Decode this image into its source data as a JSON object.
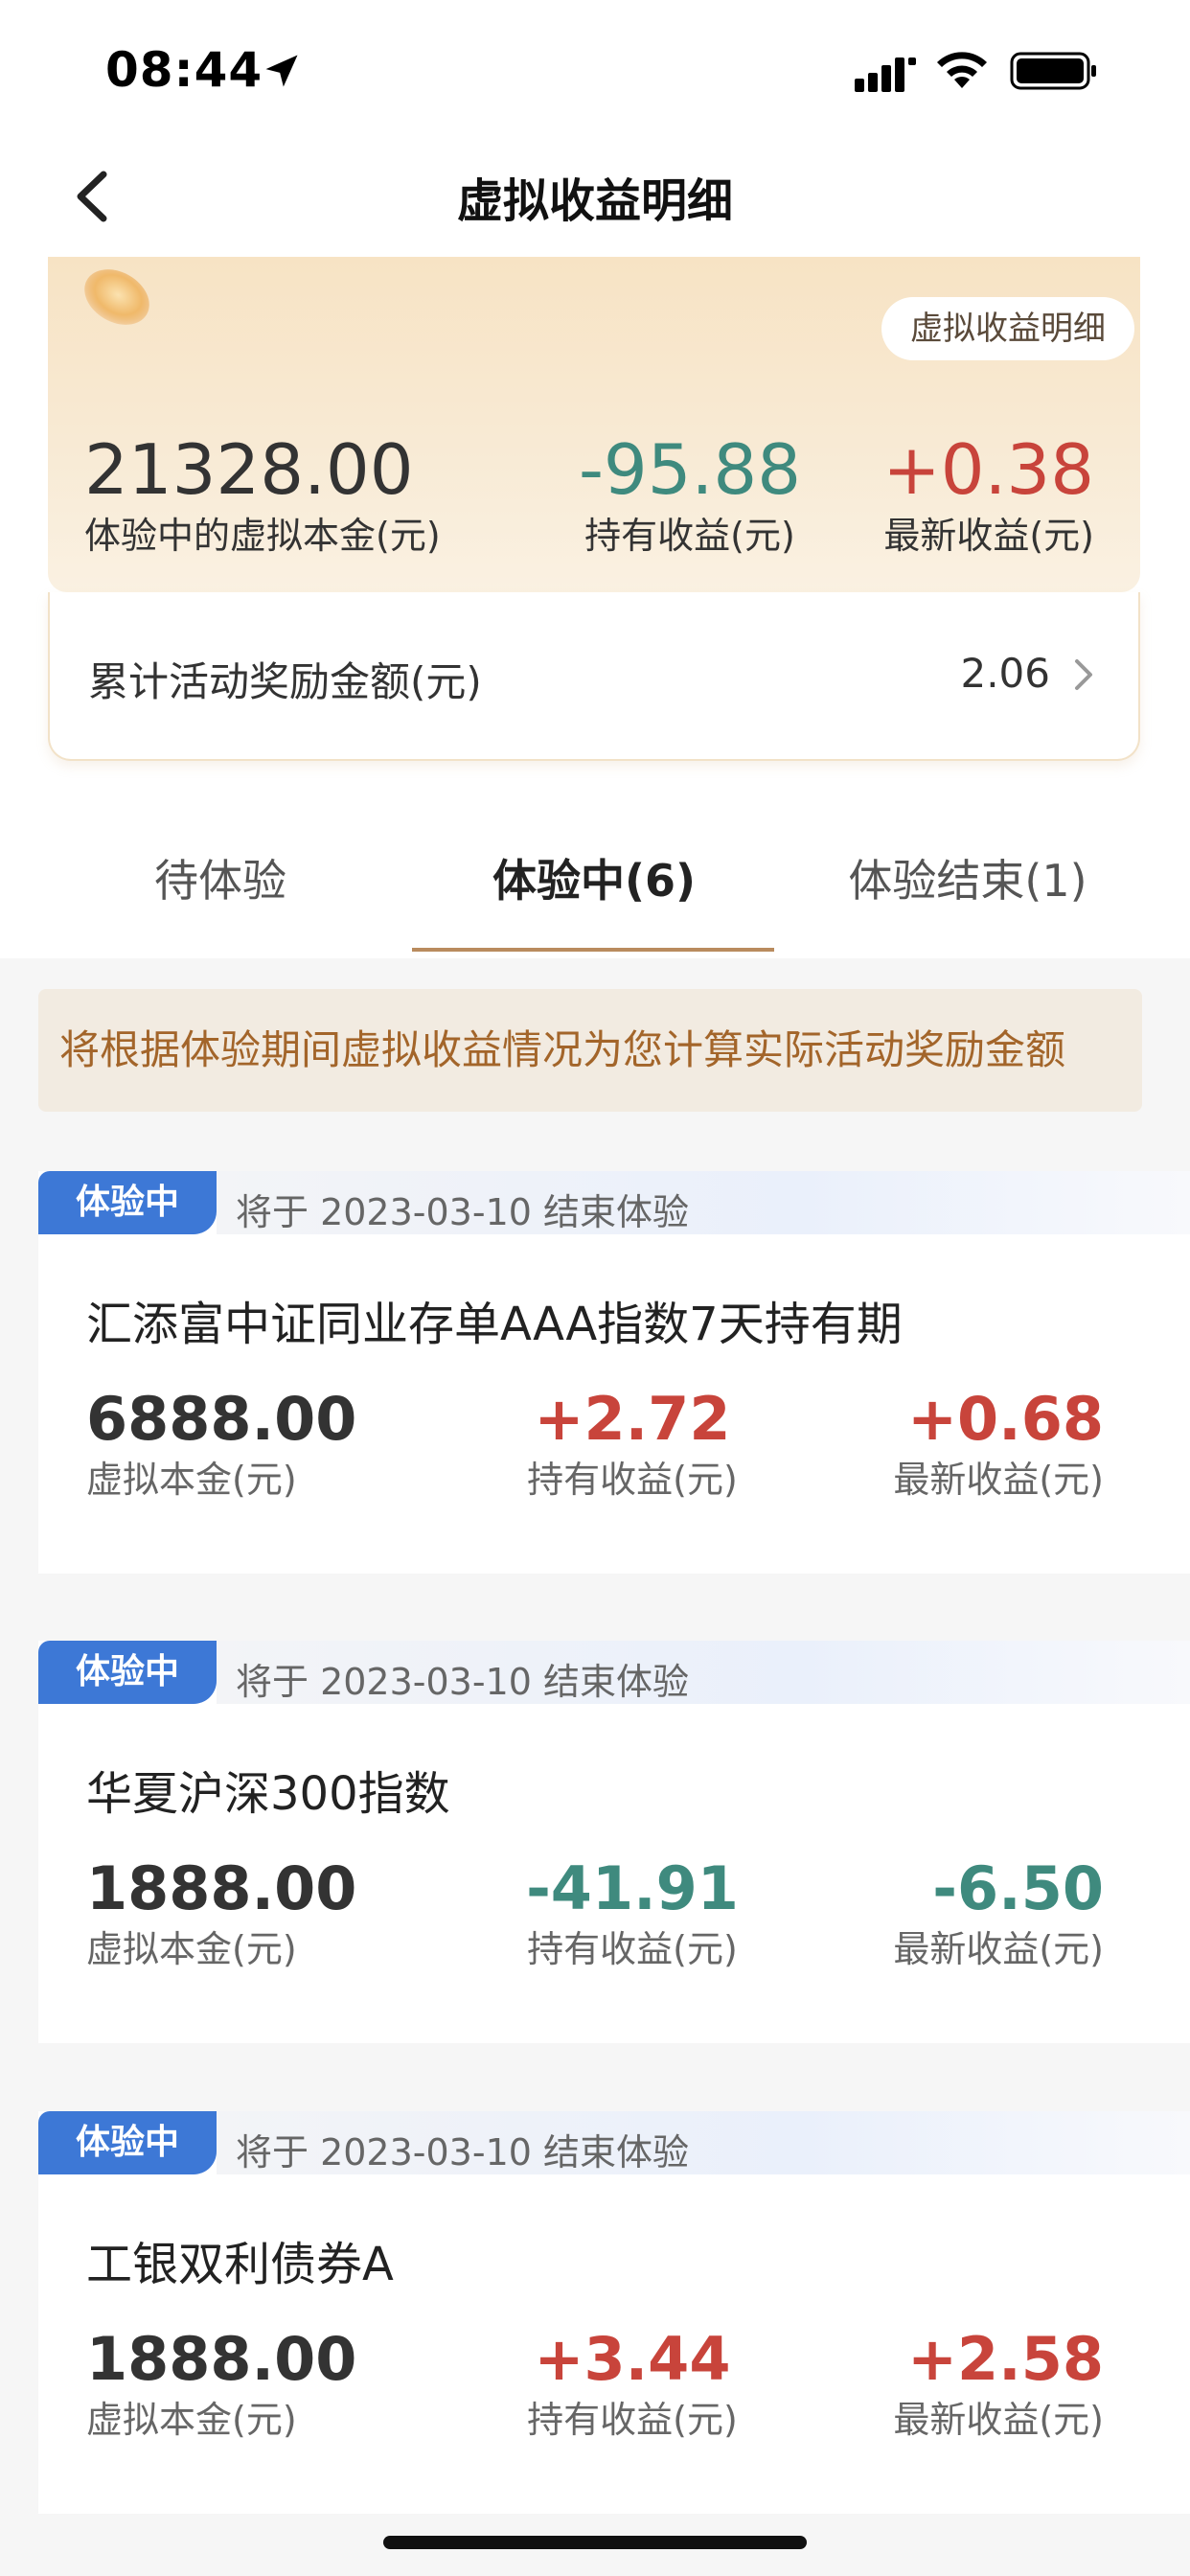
{
  "status_bar": {
    "time": "08:44"
  },
  "nav": {
    "title": "虚拟收益明细"
  },
  "summary": {
    "chip": "虚拟收益明细",
    "principal_value": "21328.00",
    "principal_label": "体验中的虚拟本金(元)",
    "hold_value": "-95.88",
    "hold_label": "持有收益(元)",
    "latest_value": "+0.38",
    "latest_label": "最新收益(元)",
    "reward_label": "累计活动奖励金额(元)",
    "reward_value": "2.06"
  },
  "tabs": {
    "pending": "待体验",
    "active": "体验中(6)",
    "ended": "体验结束(1)"
  },
  "notice": "将根据体验期间虚拟收益情况为您计算实际活动奖励金额",
  "funds": [
    {
      "badge": "体验中",
      "end_text": "将于 2023-03-10 结束体验",
      "name": "汇添富中证同业存单AAA指数7天持有期",
      "principal_value": "6888.00",
      "principal_label": "虚拟本金(元)",
      "hold_value": "+2.72",
      "hold_label": "持有收益(元)",
      "latest_value": "+0.68",
      "latest_label": "最新收益(元)"
    },
    {
      "badge": "体验中",
      "end_text": "将于 2023-03-10 结束体验",
      "name": "华夏沪深300指数",
      "principal_value": "1888.00",
      "principal_label": "虚拟本金(元)",
      "hold_value": "-41.91",
      "hold_label": "持有收益(元)",
      "latest_value": "-6.50",
      "latest_label": "最新收益(元)"
    },
    {
      "badge": "体验中",
      "end_text": "将于 2023-03-10 结束体验",
      "name": "工银双利债券A",
      "principal_value": "1888.00",
      "principal_label": "虚拟本金(元)",
      "hold_value": "+3.44",
      "hold_label": "持有收益(元)",
      "latest_value": "+2.58",
      "latest_label": "最新收益(元)"
    }
  ],
  "colors": {
    "positive": "#c8443b",
    "negative": "#3f8a7e",
    "badge": "#3d78d6",
    "accent": "#b98b5e"
  }
}
